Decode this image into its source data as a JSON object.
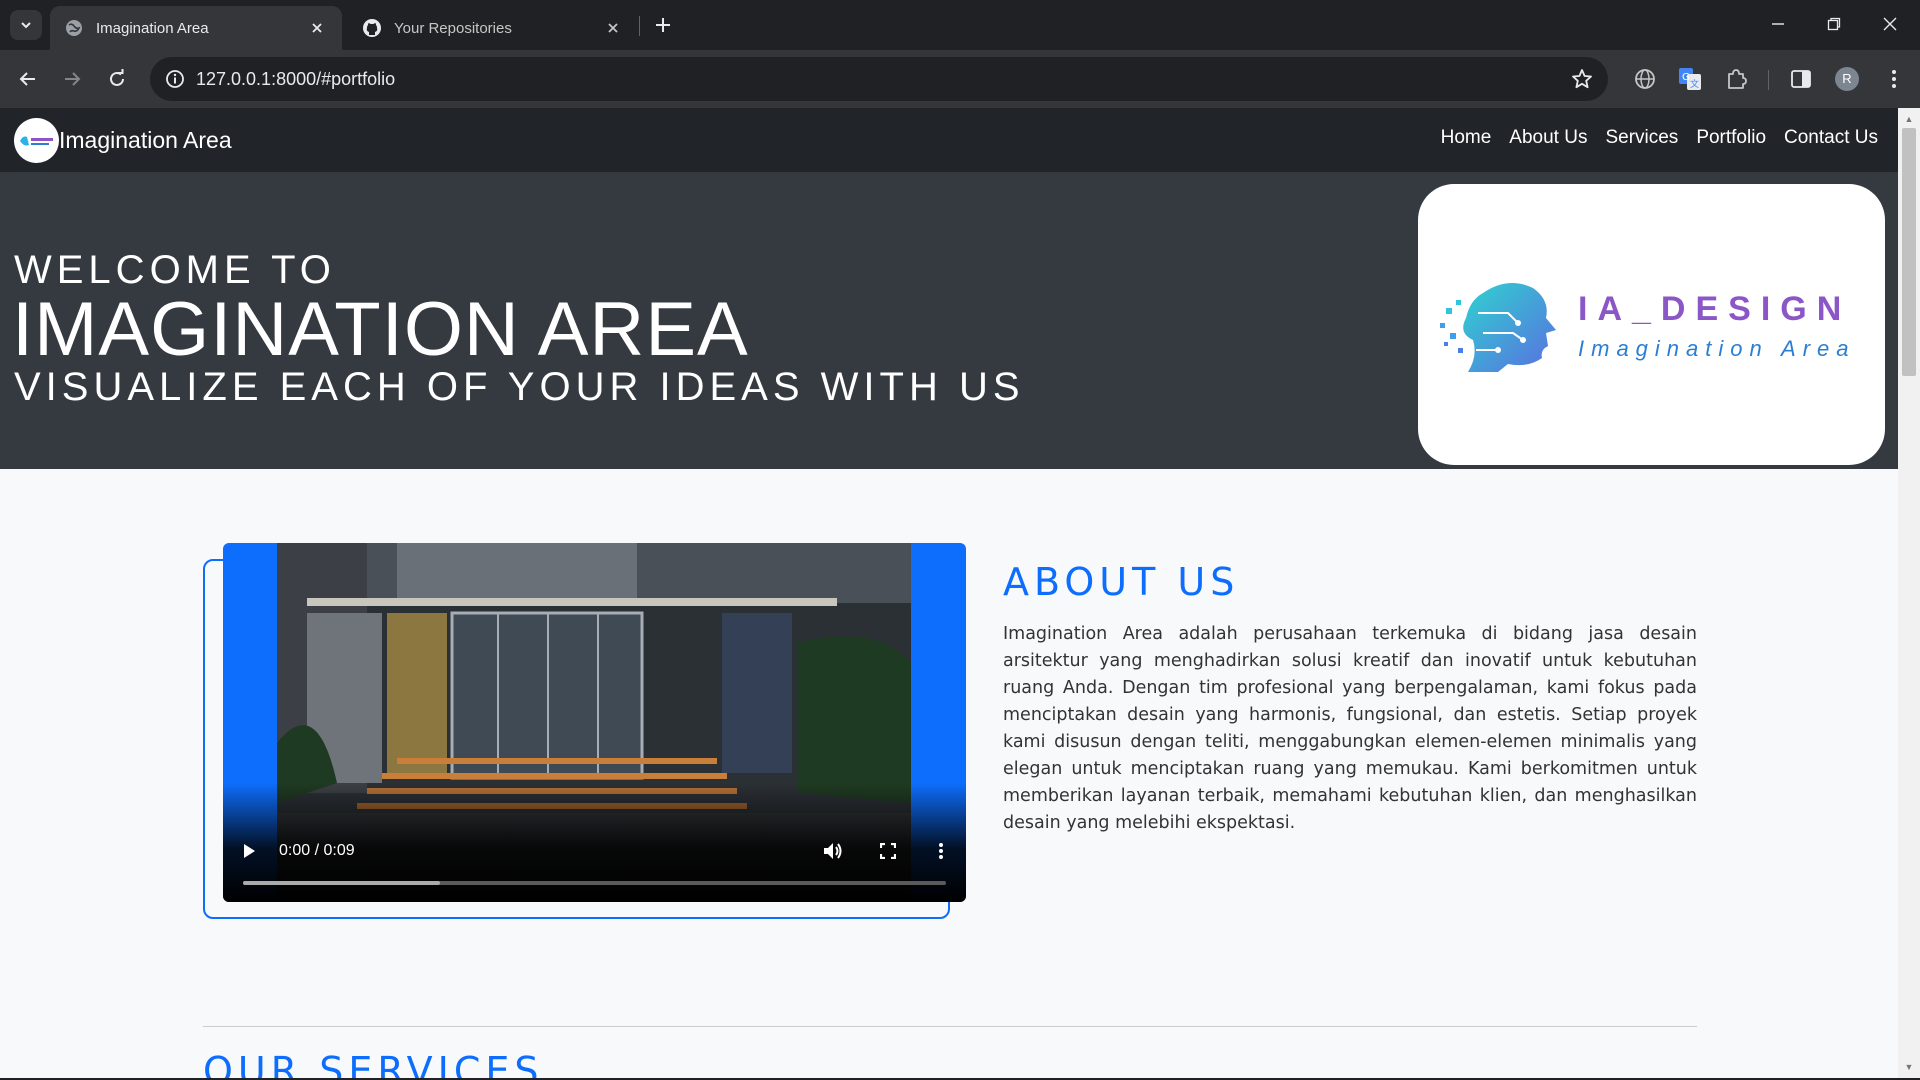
{
  "browser": {
    "tabs": [
      {
        "title": "Imagination Area",
        "active": true
      },
      {
        "title": "Your Repositories",
        "active": false
      }
    ],
    "url": "127.0.0.1:8000/#portfolio",
    "profile_initial": "R"
  },
  "site": {
    "brand": "Imagination Area",
    "nav": [
      "Home",
      "About Us",
      "Services",
      "Portfolio",
      "Contact Us"
    ],
    "hero": {
      "welcome": "WELCOME TO",
      "title": "IMAGINATION AREA",
      "tagline": "VISUALIZE EACH OF YOUR IDEAS WITH US",
      "logo_text": "IA_DESIGN",
      "logo_subtext": "Imagination Area"
    },
    "about": {
      "heading": "ABOUT US",
      "text": "Imagination Area adalah perusahaan terkemuka di bidang jasa desain arsitektur yang menghadirkan solusi kreatif dan inovatif untuk kebutuhan ruang Anda. Dengan tim profesional yang berpengalaman, kami fokus pada menciptakan desain yang harmonis, fungsional, dan estetis. Setiap proyek kami disusun dengan teliti, menggabungkan elemen-elemen minimalis yang elegan untuk menciptakan ruang yang memukau. Kami berkomitmen untuk memberikan layanan terbaik, memahami kebutuhan klien, dan menghasilkan desain yang melebihi ekspektasi."
    },
    "video": {
      "time": "0:00 / 0:09",
      "buffered_fraction": 0.28
    },
    "services_heading": "OUR SERVICES"
  },
  "colors": {
    "accent": "#0d6efd",
    "nav_bg": "#212529",
    "hero_bg": "#343a40",
    "page_bg": "#f8f9fa"
  }
}
